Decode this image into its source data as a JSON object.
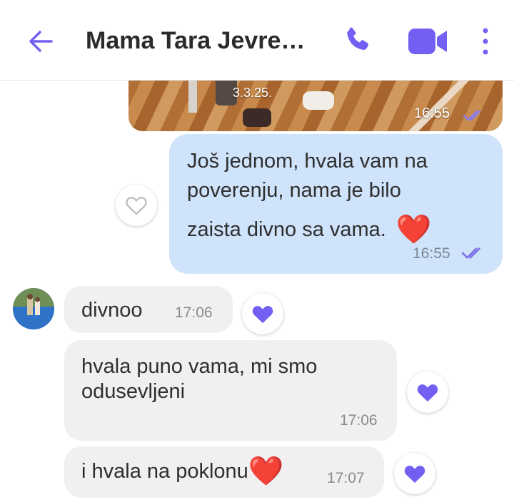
{
  "header": {
    "title": "Mama Tara Jevre…",
    "icons": [
      "back-arrow-icon",
      "phone-icon",
      "video-camera-icon",
      "more-vertical-icon"
    ],
    "accent": "#7360f2"
  },
  "photo_message": {
    "caption": "3.3.25.",
    "time": "16:55",
    "status_icon": "double-check-icon"
  },
  "outgoing": {
    "lines": [
      "Još jednom, hvala vam na",
      "poverenju, nama je bilo",
      "zaista divno sa vama."
    ],
    "emoji": "❤️",
    "time": "16:55",
    "reaction_icon": "heart-outline-icon"
  },
  "incoming": [
    {
      "text": "divnoo",
      "time": "17:06",
      "reaction_icon": "heart-filled-icon"
    },
    {
      "text_lines": [
        "hvala puno vama, mi smo",
        "odusevljeni"
      ],
      "time": "17:06",
      "reaction_icon": "heart-filled-icon"
    },
    {
      "text": "i hvala na poklonu",
      "emoji": "❤️",
      "time": "17:07",
      "reaction_icon": "heart-filled-icon"
    }
  ],
  "colors": {
    "outgoing_bubble": "#cfe3fb",
    "incoming_bubble": "#f0f0f0",
    "reaction_heart": "#7360f2",
    "emoji_heart": "#e2262c"
  }
}
